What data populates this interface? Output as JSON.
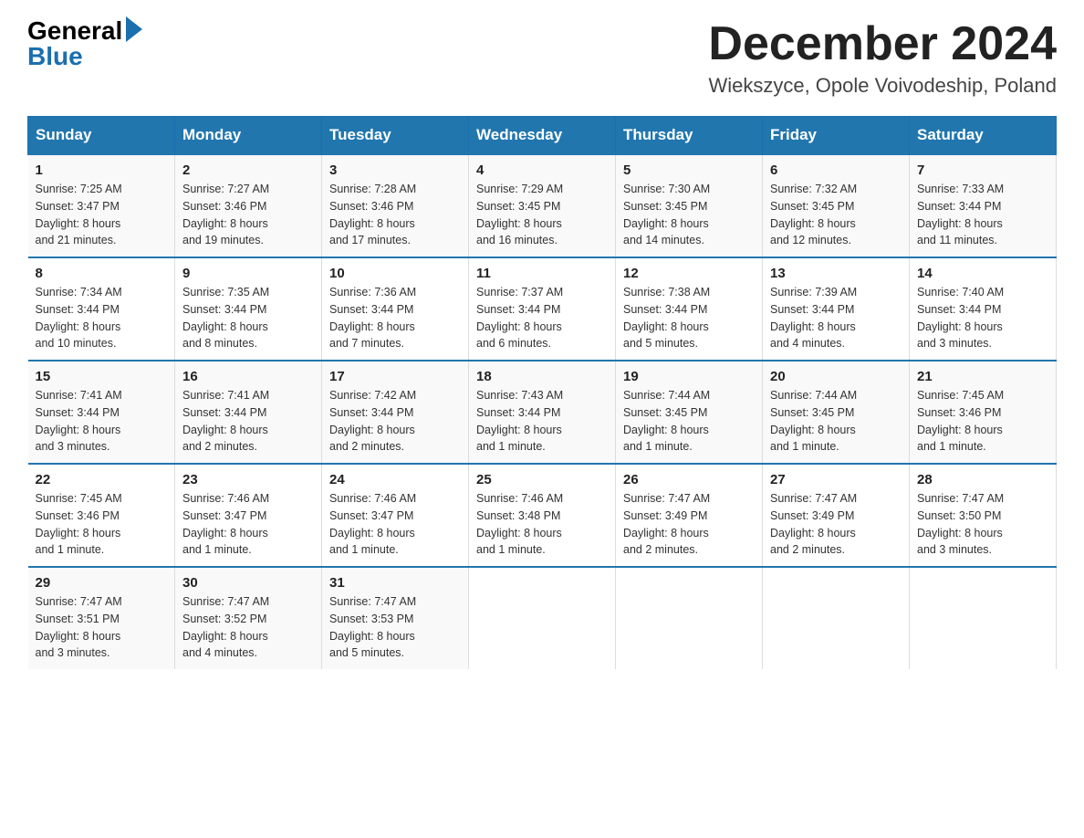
{
  "header": {
    "logo_general": "General",
    "logo_blue": "Blue",
    "month_title": "December 2024",
    "location": "Wiekszyce, Opole Voivodeship, Poland"
  },
  "weekdays": [
    "Sunday",
    "Monday",
    "Tuesday",
    "Wednesday",
    "Thursday",
    "Friday",
    "Saturday"
  ],
  "weeks": [
    [
      {
        "day": "1",
        "sunrise": "7:25 AM",
        "sunset": "3:47 PM",
        "daylight": "8 hours and 21 minutes."
      },
      {
        "day": "2",
        "sunrise": "7:27 AM",
        "sunset": "3:46 PM",
        "daylight": "8 hours and 19 minutes."
      },
      {
        "day": "3",
        "sunrise": "7:28 AM",
        "sunset": "3:46 PM",
        "daylight": "8 hours and 17 minutes."
      },
      {
        "day": "4",
        "sunrise": "7:29 AM",
        "sunset": "3:45 PM",
        "daylight": "8 hours and 16 minutes."
      },
      {
        "day": "5",
        "sunrise": "7:30 AM",
        "sunset": "3:45 PM",
        "daylight": "8 hours and 14 minutes."
      },
      {
        "day": "6",
        "sunrise": "7:32 AM",
        "sunset": "3:45 PM",
        "daylight": "8 hours and 12 minutes."
      },
      {
        "day": "7",
        "sunrise": "7:33 AM",
        "sunset": "3:44 PM",
        "daylight": "8 hours and 11 minutes."
      }
    ],
    [
      {
        "day": "8",
        "sunrise": "7:34 AM",
        "sunset": "3:44 PM",
        "daylight": "8 hours and 10 minutes."
      },
      {
        "day": "9",
        "sunrise": "7:35 AM",
        "sunset": "3:44 PM",
        "daylight": "8 hours and 8 minutes."
      },
      {
        "day": "10",
        "sunrise": "7:36 AM",
        "sunset": "3:44 PM",
        "daylight": "8 hours and 7 minutes."
      },
      {
        "day": "11",
        "sunrise": "7:37 AM",
        "sunset": "3:44 PM",
        "daylight": "8 hours and 6 minutes."
      },
      {
        "day": "12",
        "sunrise": "7:38 AM",
        "sunset": "3:44 PM",
        "daylight": "8 hours and 5 minutes."
      },
      {
        "day": "13",
        "sunrise": "7:39 AM",
        "sunset": "3:44 PM",
        "daylight": "8 hours and 4 minutes."
      },
      {
        "day": "14",
        "sunrise": "7:40 AM",
        "sunset": "3:44 PM",
        "daylight": "8 hours and 3 minutes."
      }
    ],
    [
      {
        "day": "15",
        "sunrise": "7:41 AM",
        "sunset": "3:44 PM",
        "daylight": "8 hours and 3 minutes."
      },
      {
        "day": "16",
        "sunrise": "7:41 AM",
        "sunset": "3:44 PM",
        "daylight": "8 hours and 2 minutes."
      },
      {
        "day": "17",
        "sunrise": "7:42 AM",
        "sunset": "3:44 PM",
        "daylight": "8 hours and 2 minutes."
      },
      {
        "day": "18",
        "sunrise": "7:43 AM",
        "sunset": "3:44 PM",
        "daylight": "8 hours and 1 minute."
      },
      {
        "day": "19",
        "sunrise": "7:44 AM",
        "sunset": "3:45 PM",
        "daylight": "8 hours and 1 minute."
      },
      {
        "day": "20",
        "sunrise": "7:44 AM",
        "sunset": "3:45 PM",
        "daylight": "8 hours and 1 minute."
      },
      {
        "day": "21",
        "sunrise": "7:45 AM",
        "sunset": "3:46 PM",
        "daylight": "8 hours and 1 minute."
      }
    ],
    [
      {
        "day": "22",
        "sunrise": "7:45 AM",
        "sunset": "3:46 PM",
        "daylight": "8 hours and 1 minute."
      },
      {
        "day": "23",
        "sunrise": "7:46 AM",
        "sunset": "3:47 PM",
        "daylight": "8 hours and 1 minute."
      },
      {
        "day": "24",
        "sunrise": "7:46 AM",
        "sunset": "3:47 PM",
        "daylight": "8 hours and 1 minute."
      },
      {
        "day": "25",
        "sunrise": "7:46 AM",
        "sunset": "3:48 PM",
        "daylight": "8 hours and 1 minute."
      },
      {
        "day": "26",
        "sunrise": "7:47 AM",
        "sunset": "3:49 PM",
        "daylight": "8 hours and 2 minutes."
      },
      {
        "day": "27",
        "sunrise": "7:47 AM",
        "sunset": "3:49 PM",
        "daylight": "8 hours and 2 minutes."
      },
      {
        "day": "28",
        "sunrise": "7:47 AM",
        "sunset": "3:50 PM",
        "daylight": "8 hours and 3 minutes."
      }
    ],
    [
      {
        "day": "29",
        "sunrise": "7:47 AM",
        "sunset": "3:51 PM",
        "daylight": "8 hours and 3 minutes."
      },
      {
        "day": "30",
        "sunrise": "7:47 AM",
        "sunset": "3:52 PM",
        "daylight": "8 hours and 4 minutes."
      },
      {
        "day": "31",
        "sunrise": "7:47 AM",
        "sunset": "3:53 PM",
        "daylight": "8 hours and 5 minutes."
      },
      null,
      null,
      null,
      null
    ]
  ],
  "labels": {
    "sunrise_prefix": "Sunrise: ",
    "sunset_prefix": "Sunset: ",
    "daylight_prefix": "Daylight: "
  }
}
